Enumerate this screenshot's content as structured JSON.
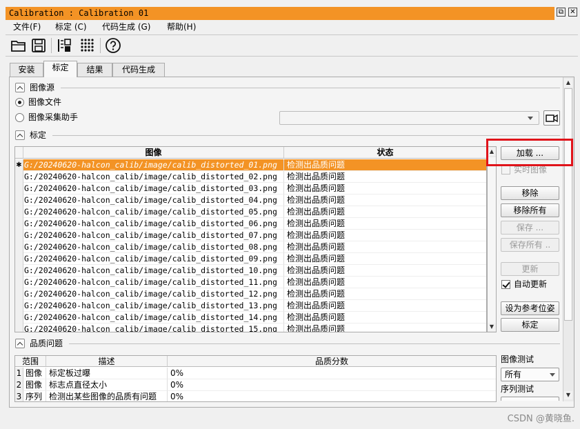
{
  "window": {
    "title": "Calibration : Calibration 01",
    "restore_glyph": "⧉",
    "close_glyph": "✕"
  },
  "menu": [
    {
      "label": "文件(F)"
    },
    {
      "label": "标定 (C)"
    },
    {
      "label": "代码生成 (G)"
    },
    {
      "label": "帮助(H)"
    }
  ],
  "toolbar": {
    "icons": [
      "open-folder-icon",
      "save-icon",
      "load-script-icon",
      "calibration-plate-icon",
      "help-icon"
    ]
  },
  "tabs": [
    {
      "label": "安装",
      "active": false
    },
    {
      "label": "标定",
      "active": true
    },
    {
      "label": "结果",
      "active": false
    },
    {
      "label": "代码生成",
      "active": false
    }
  ],
  "image_source": {
    "title": "图像源",
    "option_file": "图像文件",
    "option_assistant": "图像采集助手",
    "selected": "file"
  },
  "calibration": {
    "title": "标定",
    "columns": {
      "image": "图像",
      "status": "状态"
    },
    "selected_marker": "✱",
    "rows": [
      {
        "image": "G:/20240620-halcon_calib/image/calib_distorted_01.png",
        "status": "检测出品质问题",
        "selected": true
      },
      {
        "image": "G:/20240620-halcon_calib/image/calib_distorted_02.png",
        "status": "检测出品质问题"
      },
      {
        "image": "G:/20240620-halcon_calib/image/calib_distorted_03.png",
        "status": "检测出品质问题"
      },
      {
        "image": "G:/20240620-halcon_calib/image/calib_distorted_04.png",
        "status": "检测出品质问题"
      },
      {
        "image": "G:/20240620-halcon_calib/image/calib_distorted_05.png",
        "status": "检测出品质问题"
      },
      {
        "image": "G:/20240620-halcon_calib/image/calib_distorted_06.png",
        "status": "检测出品质问题"
      },
      {
        "image": "G:/20240620-halcon_calib/image/calib_distorted_07.png",
        "status": "检测出品质问题"
      },
      {
        "image": "G:/20240620-halcon_calib/image/calib_distorted_08.png",
        "status": "检测出品质问题"
      },
      {
        "image": "G:/20240620-halcon_calib/image/calib_distorted_09.png",
        "status": "检测出品质问题"
      },
      {
        "image": "G:/20240620-halcon_calib/image/calib_distorted_10.png",
        "status": "检测出品质问题"
      },
      {
        "image": "G:/20240620-halcon_calib/image/calib_distorted_11.png",
        "status": "检测出品质问题"
      },
      {
        "image": "G:/20240620-halcon_calib/image/calib_distorted_12.png",
        "status": "检测出品质问题"
      },
      {
        "image": "G:/20240620-halcon_calib/image/calib_distorted_13.png",
        "status": "检测出品质问题"
      },
      {
        "image": "G:/20240620-halcon_calib/image/calib_distorted_14.png",
        "status": "检测出品质问题"
      },
      {
        "image": "G:/20240620-halcon_calib/image/calib_distorted_15.png",
        "status": "检测出品质问题"
      }
    ],
    "buttons": {
      "load": "加载 ...",
      "live_image": "实时图像",
      "remove": "移除",
      "remove_all": "移除所有",
      "save": "保存 ...",
      "save_all": "保存所有 ..",
      "update": "更新",
      "auto_update": "自动更新",
      "set_reference_pose": "设为参考位姿",
      "calibrate": "标定"
    }
  },
  "quality": {
    "title": "品质问题",
    "columns": {
      "scope": "范围",
      "description": "描述",
      "score": "品质分数"
    },
    "rows": [
      {
        "index": "1",
        "scope": "图像",
        "description": "标定板过曝",
        "score": "0%"
      },
      {
        "index": "2",
        "scope": "图像",
        "description": "标志点直径太小",
        "score": "0%"
      },
      {
        "index": "3",
        "scope": "序列",
        "description": "检测出某些图像的品质有问题",
        "score": "0%"
      }
    ],
    "image_test_label": "图像测试",
    "image_test_value": "所有",
    "sequence_test_label": "序列测试"
  },
  "watermark": "CSDN @黄晓鱼."
}
